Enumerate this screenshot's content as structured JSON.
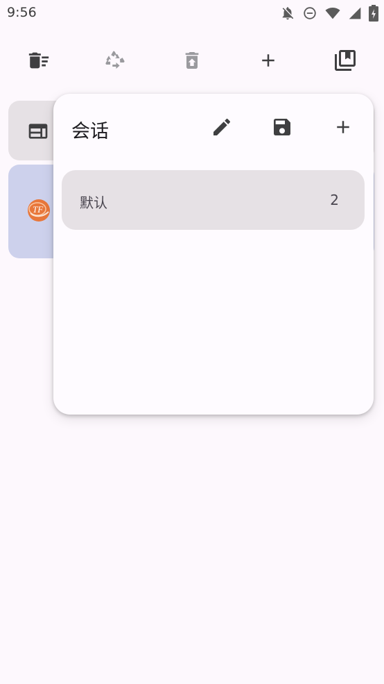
{
  "status_bar": {
    "time": "9:56",
    "icons": [
      "bell-off-icon",
      "do-not-disturb-icon",
      "wifi-icon",
      "signal-icon",
      "battery-icon"
    ]
  },
  "toolbar": {
    "icons": [
      "delete-sweep-icon",
      "recycle-icon",
      "restore-from-trash-icon",
      "add-icon",
      "bookmarks-icon"
    ]
  },
  "popup": {
    "title": "会话",
    "actions": [
      "edit-icon",
      "save-icon",
      "add-icon"
    ],
    "sessions": [
      {
        "name": "默认",
        "count": "2"
      }
    ]
  },
  "colors": {
    "background": "#FDF8FD",
    "surface": "#FEFBFF",
    "selected_item": "#E6E1E5",
    "active_tab": "#CDD1EC",
    "icon": "#3F3F41",
    "icon_disabled": "#9A9A9E"
  }
}
